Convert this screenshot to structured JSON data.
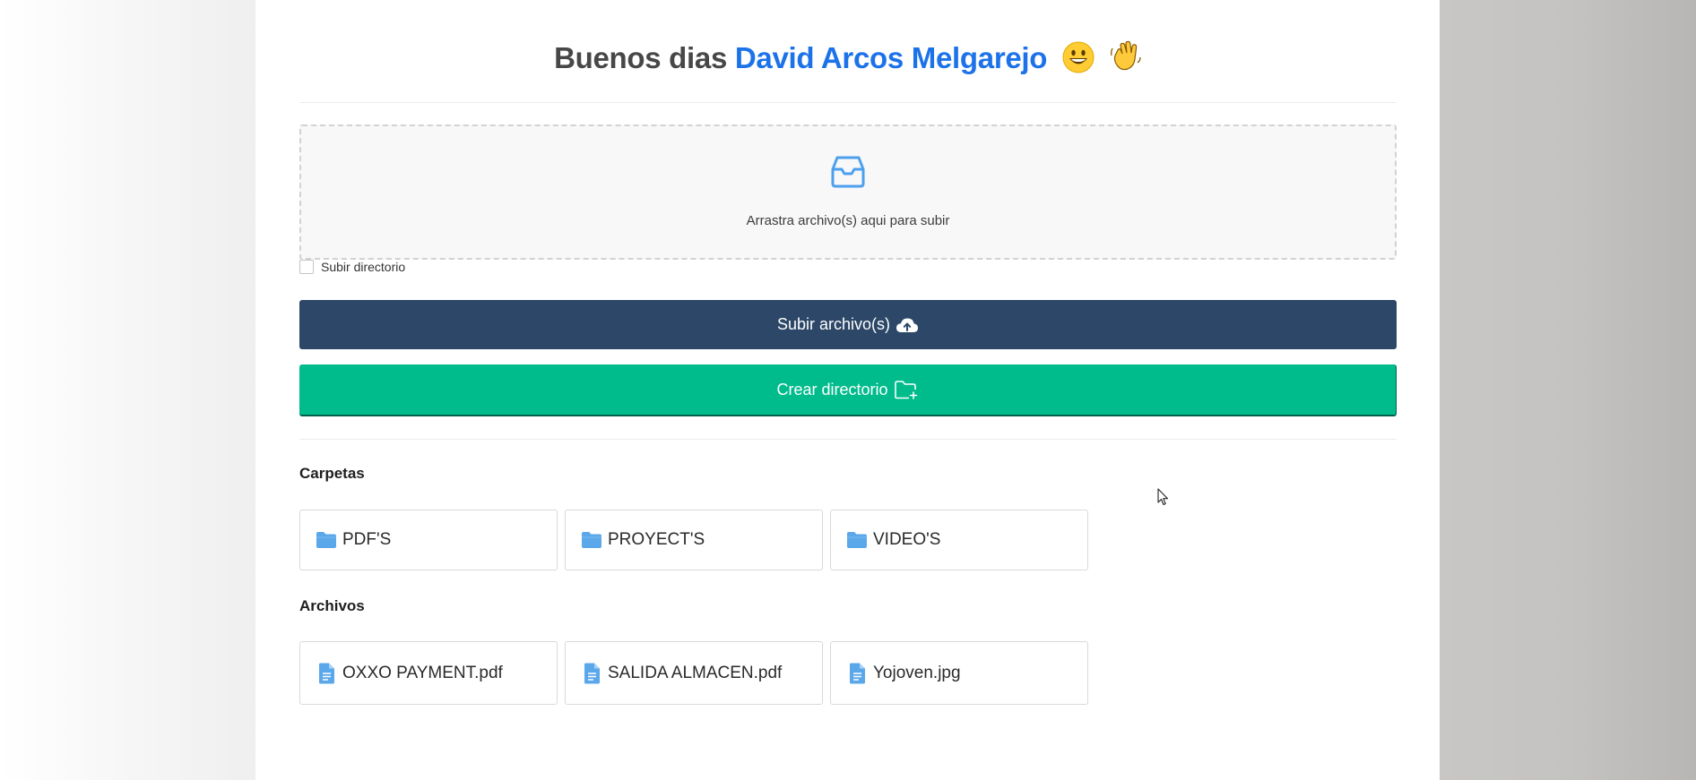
{
  "header": {
    "greeting_prefix": "Buenos dias",
    "user_name": "David Arcos Melgarejo"
  },
  "dropzone": {
    "icon": "inbox-icon",
    "text": "Arrastra archivo(s) aqui para subir"
  },
  "options": {
    "subir_directorio_label": "Subir directorio",
    "subir_directorio_checked": false
  },
  "actions": {
    "upload_label": "Subir archivo(s)",
    "upload_icon": "cloud-upload-icon",
    "mkdir_label": "Crear directorio",
    "mkdir_icon": "folder-plus-icon"
  },
  "folders": {
    "title": "Carpetas",
    "items": [
      {
        "name": "PDF'S"
      },
      {
        "name": "PROYECT'S"
      },
      {
        "name": "VIDEO'S"
      }
    ]
  },
  "files": {
    "title": "Archivos",
    "items": [
      {
        "name": "OXXO PAYMENT.pdf"
      },
      {
        "name": "SALIDA ALMACEN.pdf"
      },
      {
        "name": "Yojoven.jpg"
      }
    ]
  },
  "colors": {
    "accent_blue": "#1d72e9",
    "upload_button": "#2c4767",
    "mkdir_button": "#00bc8c",
    "icon_blue": "#5aa7ea"
  }
}
